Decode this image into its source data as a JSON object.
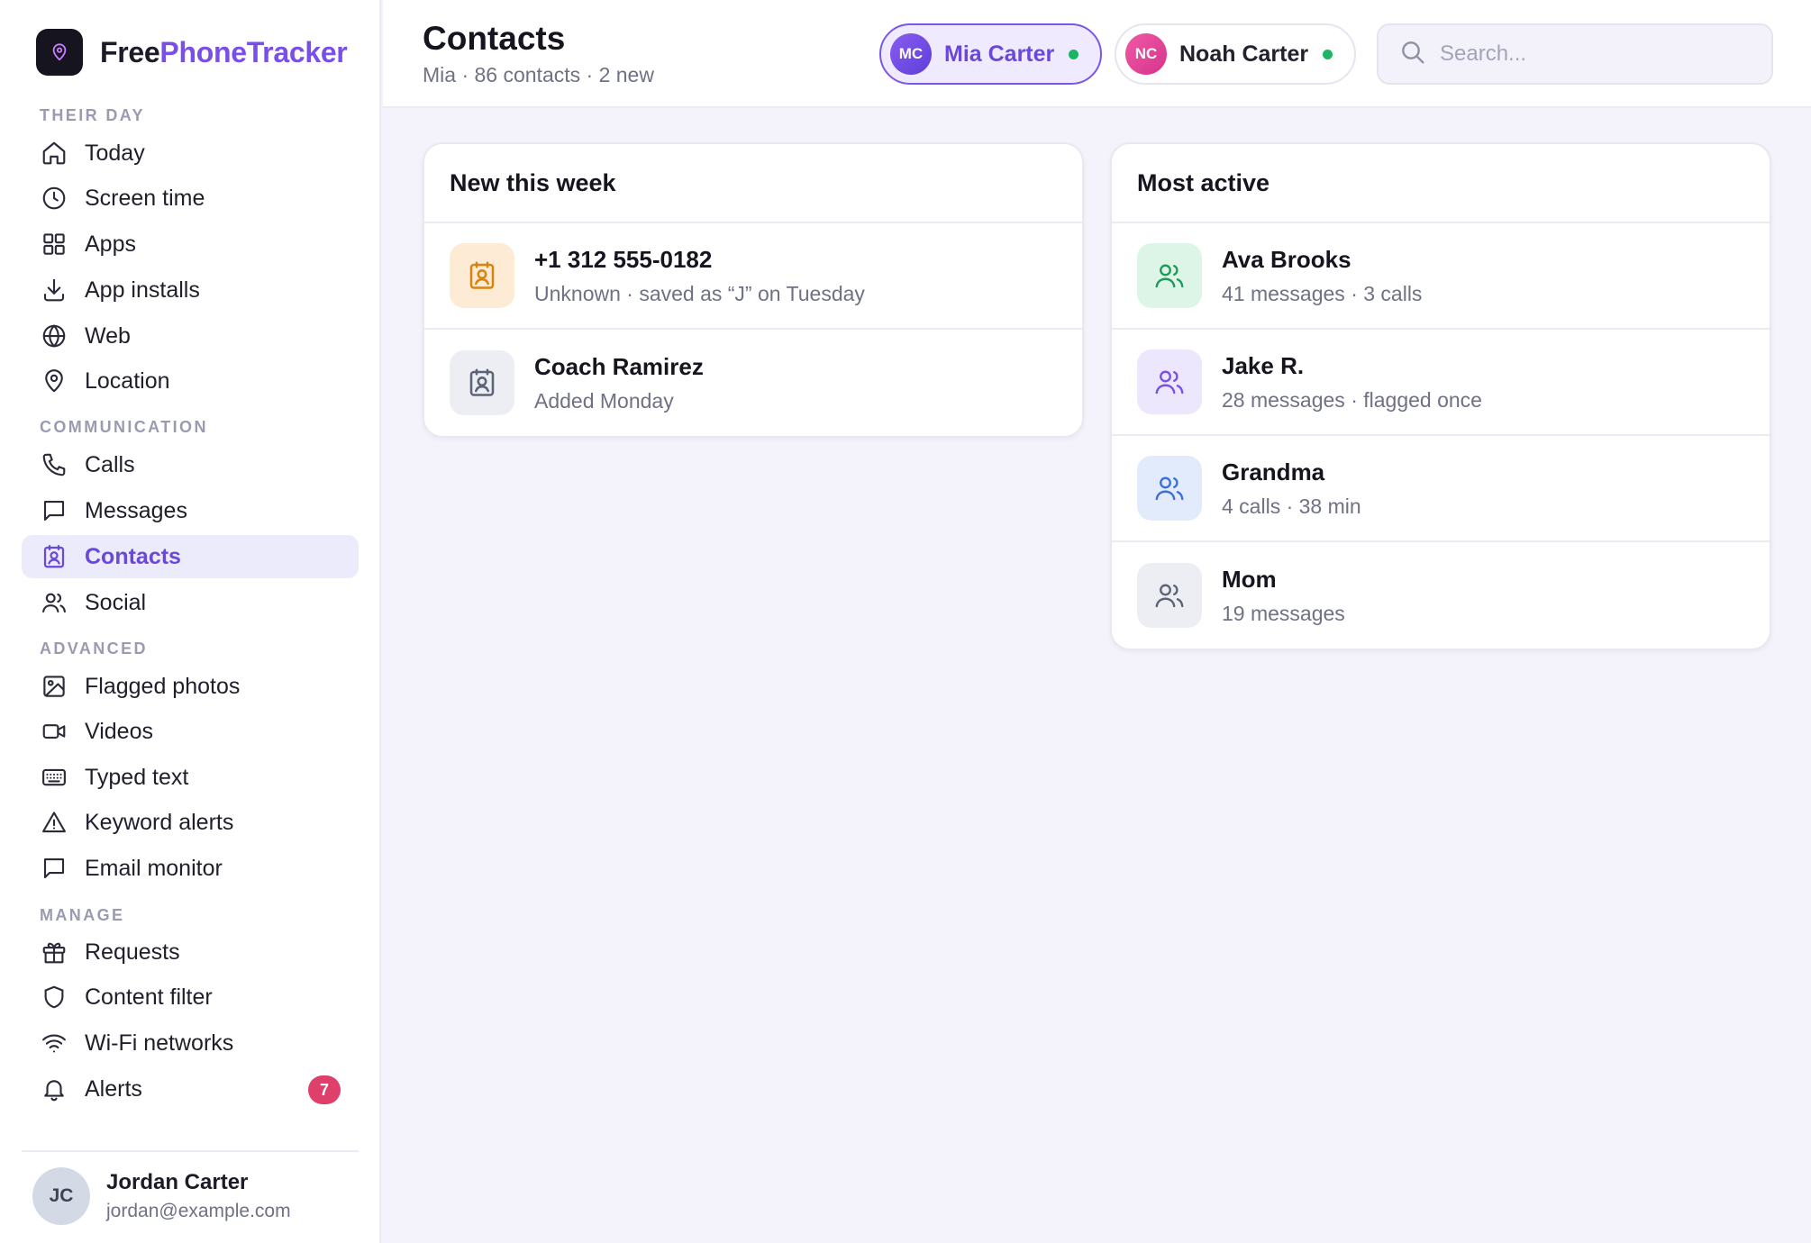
{
  "brand": {
    "part1": "Free",
    "part2": "PhoneTracker"
  },
  "sidebar": {
    "sections": {
      "their_day": "THEIR DAY",
      "communication": "COMMUNICATION",
      "advanced": "ADVANCED",
      "manage": "MANAGE"
    },
    "items": {
      "today": "Today",
      "screen_time": "Screen time",
      "apps": "Apps",
      "app_installs": "App installs",
      "web": "Web",
      "location": "Location",
      "calls": "Calls",
      "messages": "Messages",
      "contacts": "Contacts",
      "social": "Social",
      "flagged_photos": "Flagged photos",
      "videos": "Videos",
      "typed_text": "Typed text",
      "keyword_alerts": "Keyword alerts",
      "email_monitor": "Email monitor",
      "requests": "Requests",
      "content_filter": "Content filter",
      "wifi_networks": "Wi-Fi networks",
      "alerts": "Alerts"
    },
    "alerts_badge": "7",
    "active_item": "contacts"
  },
  "user": {
    "initials": "JC",
    "name": "Jordan Carter",
    "email": "jordan@example.com"
  },
  "header": {
    "title": "Contacts",
    "subtitle": "Mia · 86 contacts · 2 new",
    "children": [
      {
        "initials": "MC",
        "name": "Mia Carter",
        "status": "online",
        "selected": true
      },
      {
        "initials": "NC",
        "name": "Noah Carter",
        "status": "online",
        "selected": false
      }
    ],
    "search_placeholder": "Search..."
  },
  "new_this_week": {
    "title": "New this week",
    "items": [
      {
        "title": "+1 312 555-0182",
        "sub": "Unknown · saved as “J” on Tuesday"
      },
      {
        "title": "Coach Ramirez",
        "sub": "Added Monday"
      }
    ]
  },
  "most_active": {
    "title": "Most active",
    "items": [
      {
        "title": "Ava Brooks",
        "sub": "41 messages · 3 calls"
      },
      {
        "title": "Jake R.",
        "sub": "28 messages · flagged once"
      },
      {
        "title": "Grandma",
        "sub": "4 calls · 38 min"
      },
      {
        "title": "Mom",
        "sub": "19 messages"
      }
    ]
  },
  "colors": {
    "accent": "#7a4fe8",
    "active_nav_bg": "#ecebfb",
    "online": "#1fb465",
    "badge": "#de3f6b"
  }
}
